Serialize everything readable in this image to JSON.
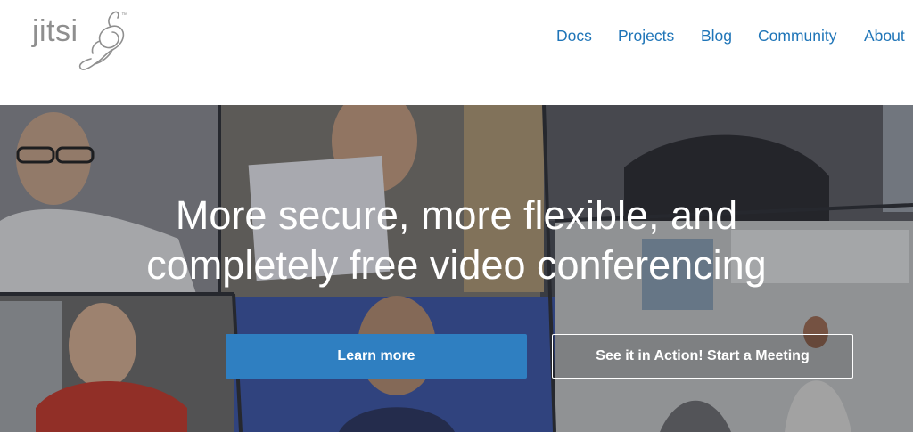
{
  "header": {
    "logo": {
      "text": "jitsi",
      "trademark": "™",
      "icon": "jitsi-bird-logo-icon"
    },
    "nav": [
      {
        "label": "Docs"
      },
      {
        "label": "Projects"
      },
      {
        "label": "Blog"
      },
      {
        "label": "Community"
      },
      {
        "label": "About"
      }
    ],
    "link_color": "#1f75b8"
  },
  "hero": {
    "title_line1": "More secure, more flexible, and",
    "title_line2": "completely free video conferencing",
    "learn_more_label": "Learn more",
    "start_meeting_label": "See it in Action! Start a Meeting",
    "primary_button_color": "#2f7fc1"
  }
}
